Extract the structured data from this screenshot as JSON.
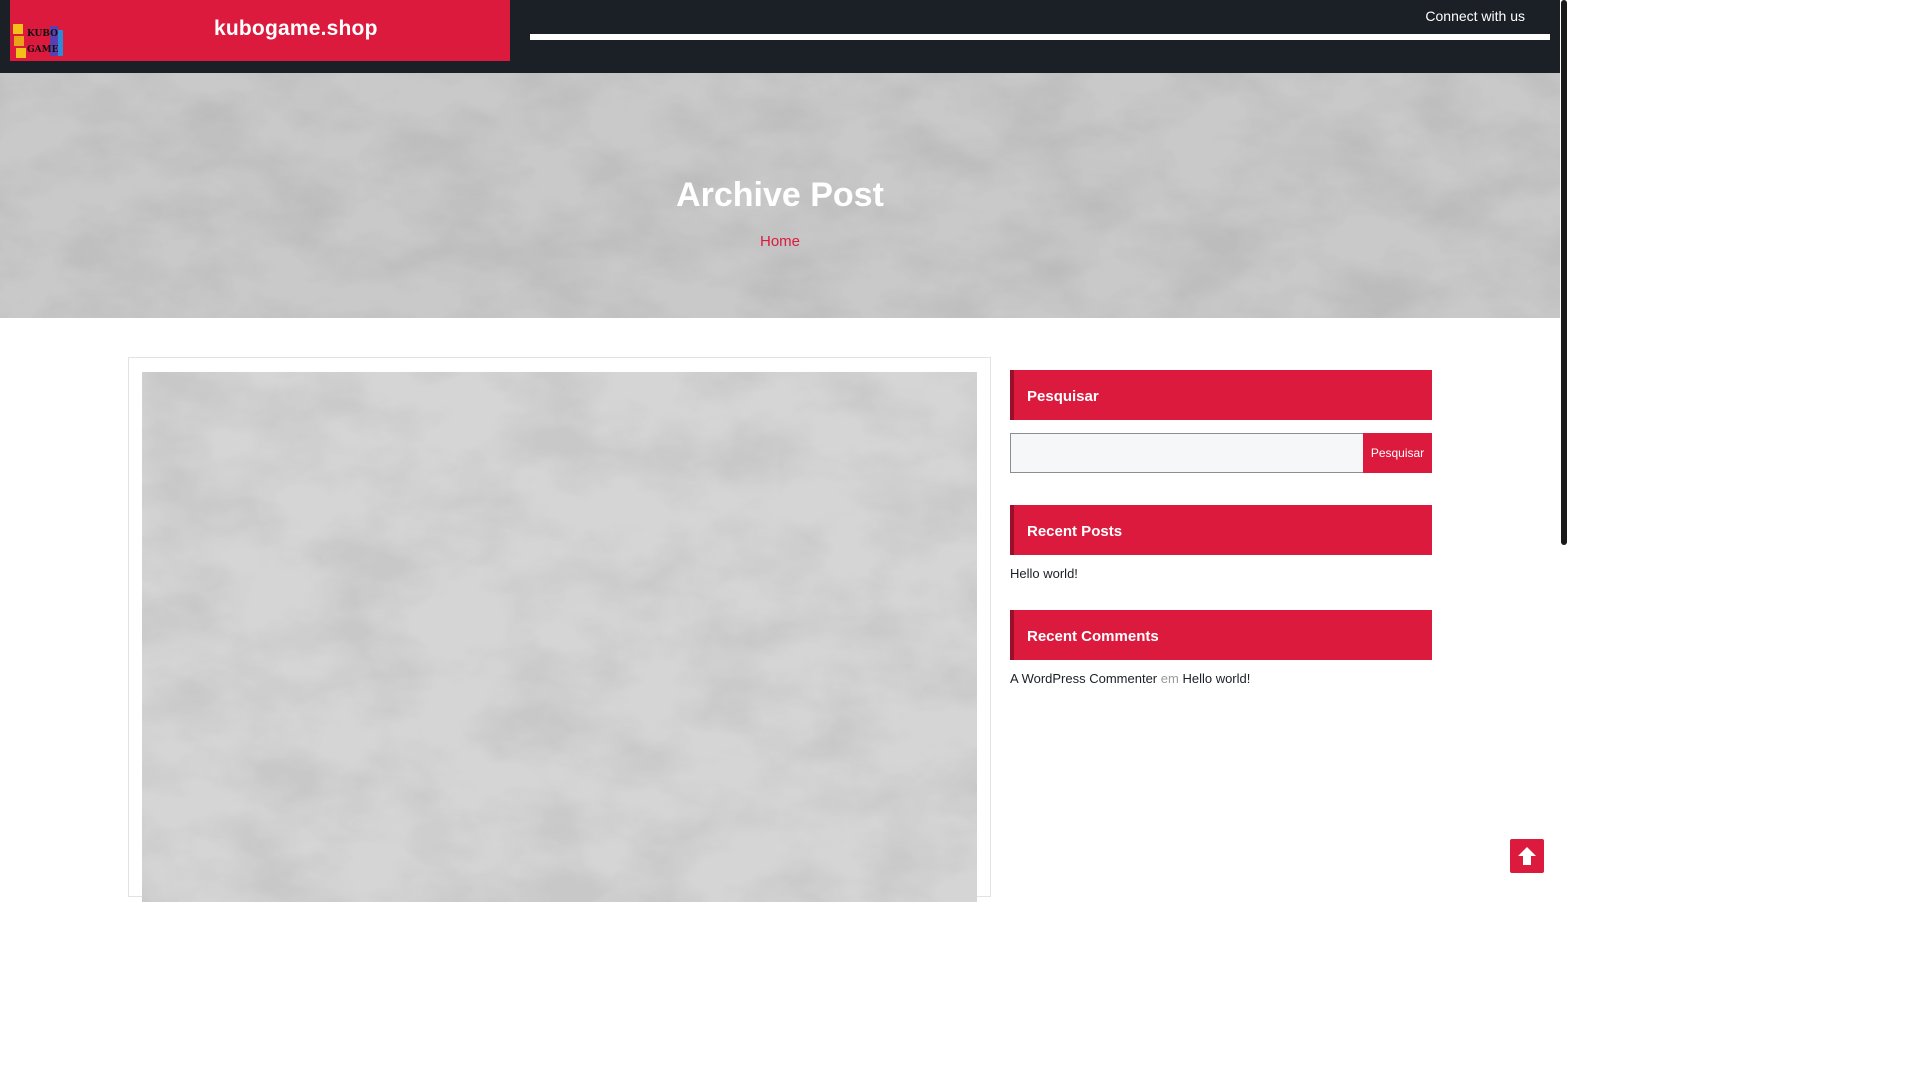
{
  "header": {
    "site_title": "kubogame.shop",
    "connect_text": "Connect with us",
    "logo_text": "KUBO GAME"
  },
  "hero": {
    "title": "Archive Post",
    "breadcrumb": "Home"
  },
  "sidebar": {
    "search": {
      "heading": "Pesquisar",
      "button_label": "Pesquisar",
      "placeholder": ""
    },
    "recent_posts": {
      "heading": "Recent Posts",
      "items": [
        "Hello world!"
      ]
    },
    "recent_comments": {
      "heading": "Recent Comments",
      "author": "A WordPress Commenter",
      "separator": "em",
      "post": "Hello world!"
    }
  },
  "colors": {
    "accent": "#dc1a3d",
    "dark": "#1b1f26"
  },
  "icons": {
    "back_to_top": "arrow-up-icon"
  }
}
